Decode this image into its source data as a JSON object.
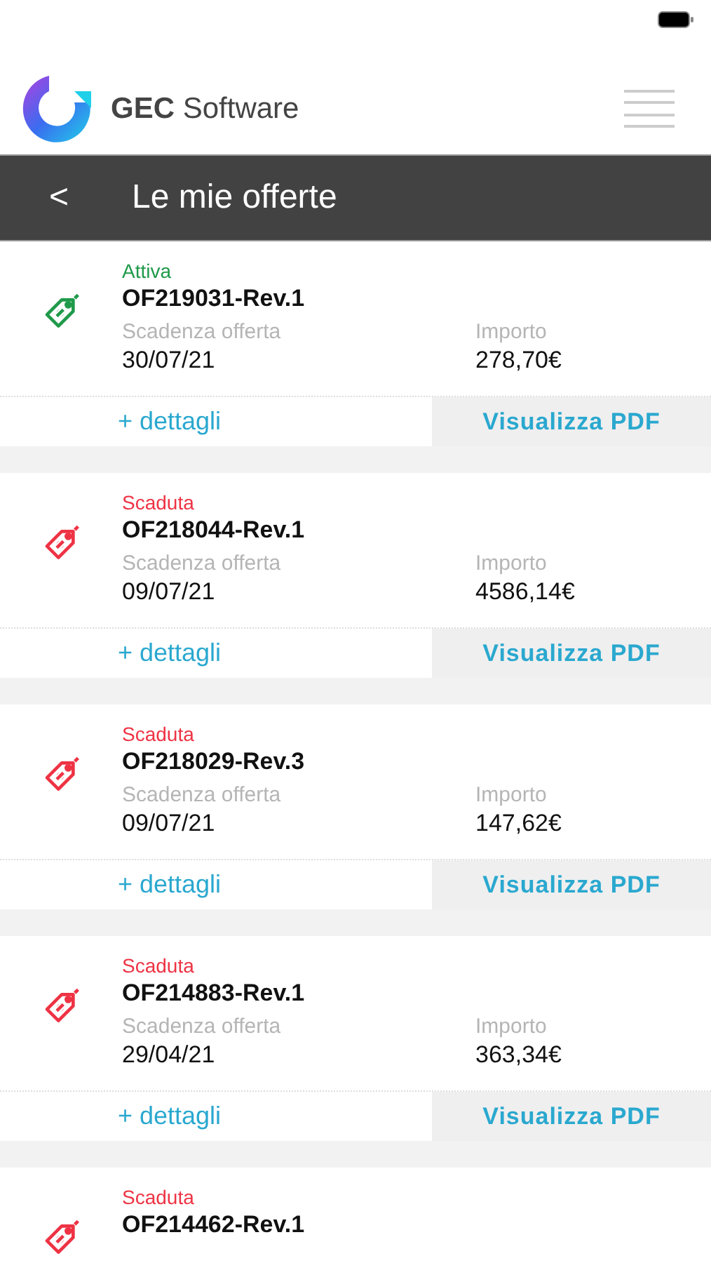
{
  "header": {
    "brand_bold": "GEC",
    "brand": "Software"
  },
  "title_bar": {
    "back": "<",
    "title": "Le mie offerte"
  },
  "offers": [
    {
      "status": "Attiva",
      "color": "#1f9a4a",
      "code": "OF219031-Rev.1",
      "expiry_label": "Scadenza offerta",
      "expiry": "30/07/21",
      "amount_label": "Importo",
      "amount": "278,70€",
      "details": "+ dettagli",
      "pdf": "Visualizza PDF"
    },
    {
      "status": "Scaduta",
      "color": "#ee3344",
      "code": "OF218044-Rev.1",
      "expiry_label": "Scadenza offerta",
      "expiry": "09/07/21",
      "amount_label": "Importo",
      "amount": "4586,14€",
      "details": "+ dettagli",
      "pdf": "Visualizza PDF"
    },
    {
      "status": "Scaduta",
      "color": "#ee3344",
      "code": "OF218029-Rev.3",
      "expiry_label": "Scadenza offerta",
      "expiry": "09/07/21",
      "amount_label": "Importo",
      "amount": "147,62€",
      "details": "+ dettagli",
      "pdf": "Visualizza PDF"
    },
    {
      "status": "Scaduta",
      "color": "#ee3344",
      "code": "OF214883-Rev.1",
      "expiry_label": "Scadenza offerta",
      "expiry": "29/04/21",
      "amount_label": "Importo",
      "amount": "363,34€",
      "details": "+ dettagli",
      "pdf": "Visualizza PDF"
    },
    {
      "status": "Scaduta",
      "color": "#ee3344",
      "code": "OF214462-Rev.1"
    }
  ]
}
